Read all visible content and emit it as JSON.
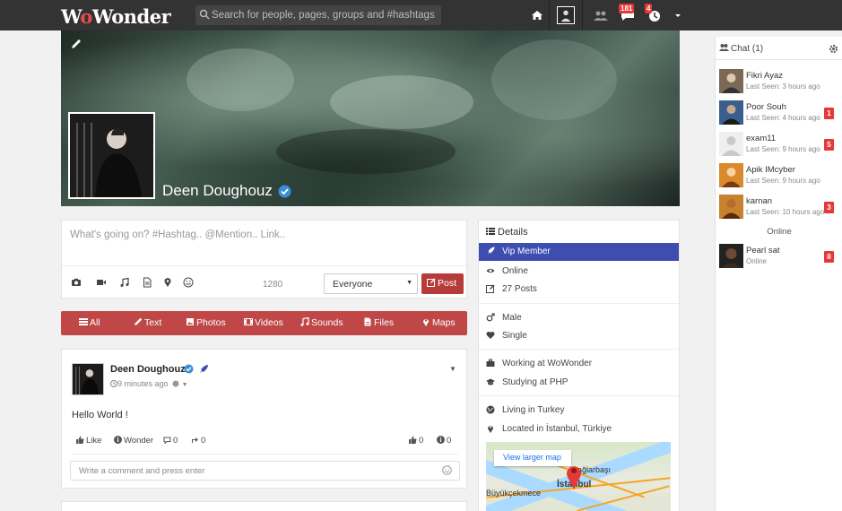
{
  "brand": {
    "logo_text_1": "W",
    "logo_text_o": "o",
    "logo_text_2": "Wonder"
  },
  "search": {
    "placeholder": "Search for people, pages, groups and #hashtags..."
  },
  "header": {
    "notifications_count": "181",
    "messages_count": "4"
  },
  "profile": {
    "name": "Deen Doughouz"
  },
  "composer": {
    "placeholder": "What's going on? #Hashtag.. @Mention.. Link..",
    "char_count": "1280",
    "privacy": "Everyone",
    "post_label": "Post"
  },
  "filters": [
    {
      "label": "All"
    },
    {
      "label": "Text"
    },
    {
      "label": "Photos"
    },
    {
      "label": "Videos"
    },
    {
      "label": "Sounds"
    },
    {
      "label": "Files"
    },
    {
      "label": "Maps"
    }
  ],
  "post": {
    "author": "Deen Doughouz",
    "time": "9 minutes ago",
    "text": "Hello World !",
    "like_label": "Like",
    "wonder_label": "Wonder",
    "comments_count": "0",
    "shares_count": "0",
    "likes_count": "0",
    "wonders_count": "0",
    "comment_placeholder": "Write a comment and press enter"
  },
  "details": {
    "title": "Details",
    "vip": "Vip Member",
    "online": "Online",
    "posts": "27 Posts",
    "gender": "Male",
    "relationship": "Single",
    "working": "Working at WoWonder",
    "studying": "Studying at PHP",
    "living": "Living in Turkey",
    "located": "Located in İstanbul, Türkiye",
    "map_button": "View larger map",
    "map_labels": [
      "Bağlarbaşı",
      "Büyükçekmece",
      "İstanbul"
    ]
  },
  "chat": {
    "title": "Chat (1)",
    "online_label": "Online",
    "users": [
      {
        "name": "Fikri Ayaz",
        "seen": "Last Seen: 3 hours ago",
        "badge": "",
        "color": "#7a6a55"
      },
      {
        "name": "Poor Souh",
        "seen": "Last Seen: 4 hours ago",
        "badge": "1",
        "color": "#3a5f8f"
      },
      {
        "name": "exam11",
        "seen": "Last Seen: 9 hours ago",
        "badge": "5",
        "color": "#c9c9c9"
      },
      {
        "name": "Apik IMcyber",
        "seen": "Last Seen: 9 hours ago",
        "badge": "",
        "color": "#d98a2b"
      },
      {
        "name": "karnan",
        "seen": "Last Seen: 10 hours ago",
        "badge": "3",
        "color": "#c6822e"
      }
    ],
    "online_users": [
      {
        "name": "Pearl sat",
        "seen": "Online",
        "badge": "8",
        "color": "#222222"
      }
    ]
  }
}
